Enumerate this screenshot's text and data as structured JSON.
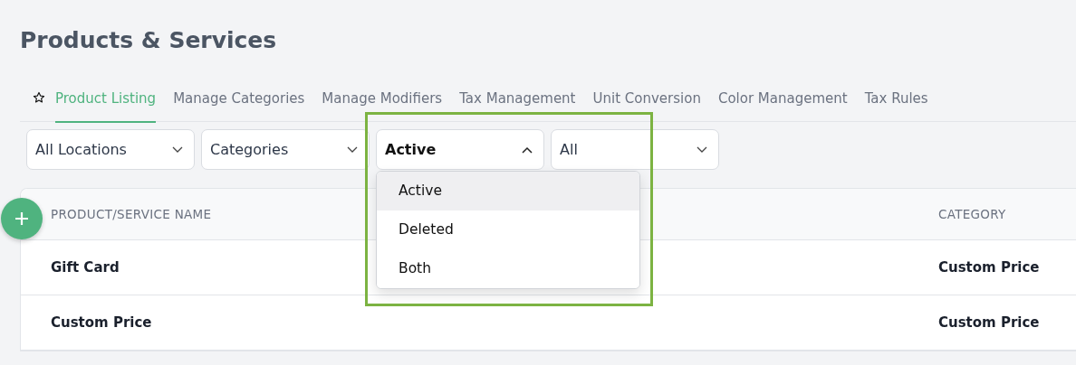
{
  "page_title": "Products & Services",
  "tabs": [
    {
      "label": "Product Listing",
      "selected": true
    },
    {
      "label": "Manage Categories",
      "selected": false
    },
    {
      "label": "Manage Modifiers",
      "selected": false
    },
    {
      "label": "Tax Management",
      "selected": false
    },
    {
      "label": "Unit Conversion",
      "selected": false
    },
    {
      "label": "Color Management",
      "selected": false
    },
    {
      "label": "Tax Rules",
      "selected": false
    }
  ],
  "filters": [
    {
      "value": "All Locations",
      "expanded": false,
      "emphasized": false
    },
    {
      "value": "Categories",
      "expanded": false,
      "emphasized": false
    },
    {
      "value": "Active",
      "expanded": true,
      "emphasized": true,
      "options": [
        {
          "label": "Active",
          "selected": true
        },
        {
          "label": "Deleted",
          "selected": false
        },
        {
          "label": "Both",
          "selected": false
        }
      ]
    },
    {
      "value": "All",
      "expanded": false,
      "emphasized": false
    }
  ],
  "highlight": true,
  "table": {
    "columns": [
      "PRODUCT/SERVICE NAME",
      "CATEGORY"
    ],
    "rows": [
      [
        "Gift Card",
        "Custom Price"
      ],
      [
        "Custom Price",
        "Custom Price"
      ]
    ]
  }
}
